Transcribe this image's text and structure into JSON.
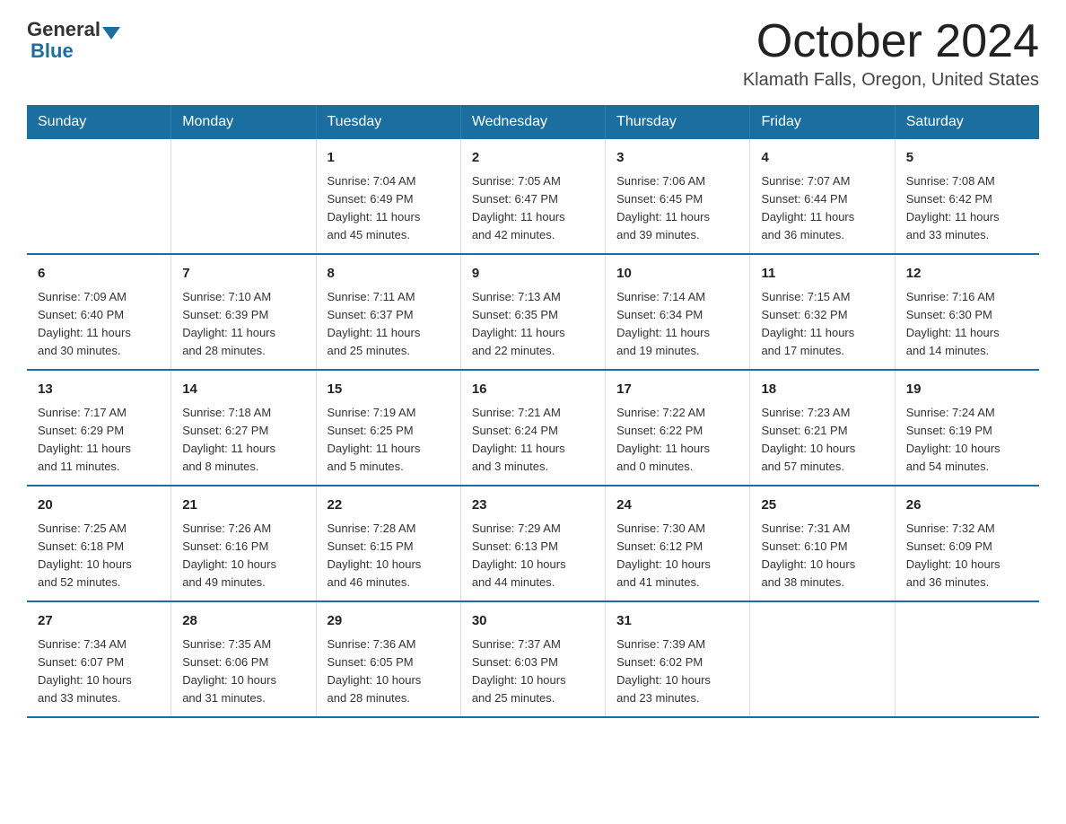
{
  "logo": {
    "general": "General",
    "blue": "Blue"
  },
  "title": "October 2024",
  "location": "Klamath Falls, Oregon, United States",
  "days_of_week": [
    "Sunday",
    "Monday",
    "Tuesday",
    "Wednesday",
    "Thursday",
    "Friday",
    "Saturday"
  ],
  "weeks": [
    [
      {
        "day": "",
        "info": ""
      },
      {
        "day": "",
        "info": ""
      },
      {
        "day": "1",
        "info": "Sunrise: 7:04 AM\nSunset: 6:49 PM\nDaylight: 11 hours\nand 45 minutes."
      },
      {
        "day": "2",
        "info": "Sunrise: 7:05 AM\nSunset: 6:47 PM\nDaylight: 11 hours\nand 42 minutes."
      },
      {
        "day": "3",
        "info": "Sunrise: 7:06 AM\nSunset: 6:45 PM\nDaylight: 11 hours\nand 39 minutes."
      },
      {
        "day": "4",
        "info": "Sunrise: 7:07 AM\nSunset: 6:44 PM\nDaylight: 11 hours\nand 36 minutes."
      },
      {
        "day": "5",
        "info": "Sunrise: 7:08 AM\nSunset: 6:42 PM\nDaylight: 11 hours\nand 33 minutes."
      }
    ],
    [
      {
        "day": "6",
        "info": "Sunrise: 7:09 AM\nSunset: 6:40 PM\nDaylight: 11 hours\nand 30 minutes."
      },
      {
        "day": "7",
        "info": "Sunrise: 7:10 AM\nSunset: 6:39 PM\nDaylight: 11 hours\nand 28 minutes."
      },
      {
        "day": "8",
        "info": "Sunrise: 7:11 AM\nSunset: 6:37 PM\nDaylight: 11 hours\nand 25 minutes."
      },
      {
        "day": "9",
        "info": "Sunrise: 7:13 AM\nSunset: 6:35 PM\nDaylight: 11 hours\nand 22 minutes."
      },
      {
        "day": "10",
        "info": "Sunrise: 7:14 AM\nSunset: 6:34 PM\nDaylight: 11 hours\nand 19 minutes."
      },
      {
        "day": "11",
        "info": "Sunrise: 7:15 AM\nSunset: 6:32 PM\nDaylight: 11 hours\nand 17 minutes."
      },
      {
        "day": "12",
        "info": "Sunrise: 7:16 AM\nSunset: 6:30 PM\nDaylight: 11 hours\nand 14 minutes."
      }
    ],
    [
      {
        "day": "13",
        "info": "Sunrise: 7:17 AM\nSunset: 6:29 PM\nDaylight: 11 hours\nand 11 minutes."
      },
      {
        "day": "14",
        "info": "Sunrise: 7:18 AM\nSunset: 6:27 PM\nDaylight: 11 hours\nand 8 minutes."
      },
      {
        "day": "15",
        "info": "Sunrise: 7:19 AM\nSunset: 6:25 PM\nDaylight: 11 hours\nand 5 minutes."
      },
      {
        "day": "16",
        "info": "Sunrise: 7:21 AM\nSunset: 6:24 PM\nDaylight: 11 hours\nand 3 minutes."
      },
      {
        "day": "17",
        "info": "Sunrise: 7:22 AM\nSunset: 6:22 PM\nDaylight: 11 hours\nand 0 minutes."
      },
      {
        "day": "18",
        "info": "Sunrise: 7:23 AM\nSunset: 6:21 PM\nDaylight: 10 hours\nand 57 minutes."
      },
      {
        "day": "19",
        "info": "Sunrise: 7:24 AM\nSunset: 6:19 PM\nDaylight: 10 hours\nand 54 minutes."
      }
    ],
    [
      {
        "day": "20",
        "info": "Sunrise: 7:25 AM\nSunset: 6:18 PM\nDaylight: 10 hours\nand 52 minutes."
      },
      {
        "day": "21",
        "info": "Sunrise: 7:26 AM\nSunset: 6:16 PM\nDaylight: 10 hours\nand 49 minutes."
      },
      {
        "day": "22",
        "info": "Sunrise: 7:28 AM\nSunset: 6:15 PM\nDaylight: 10 hours\nand 46 minutes."
      },
      {
        "day": "23",
        "info": "Sunrise: 7:29 AM\nSunset: 6:13 PM\nDaylight: 10 hours\nand 44 minutes."
      },
      {
        "day": "24",
        "info": "Sunrise: 7:30 AM\nSunset: 6:12 PM\nDaylight: 10 hours\nand 41 minutes."
      },
      {
        "day": "25",
        "info": "Sunrise: 7:31 AM\nSunset: 6:10 PM\nDaylight: 10 hours\nand 38 minutes."
      },
      {
        "day": "26",
        "info": "Sunrise: 7:32 AM\nSunset: 6:09 PM\nDaylight: 10 hours\nand 36 minutes."
      }
    ],
    [
      {
        "day": "27",
        "info": "Sunrise: 7:34 AM\nSunset: 6:07 PM\nDaylight: 10 hours\nand 33 minutes."
      },
      {
        "day": "28",
        "info": "Sunrise: 7:35 AM\nSunset: 6:06 PM\nDaylight: 10 hours\nand 31 minutes."
      },
      {
        "day": "29",
        "info": "Sunrise: 7:36 AM\nSunset: 6:05 PM\nDaylight: 10 hours\nand 28 minutes."
      },
      {
        "day": "30",
        "info": "Sunrise: 7:37 AM\nSunset: 6:03 PM\nDaylight: 10 hours\nand 25 minutes."
      },
      {
        "day": "31",
        "info": "Sunrise: 7:39 AM\nSunset: 6:02 PM\nDaylight: 10 hours\nand 23 minutes."
      },
      {
        "day": "",
        "info": ""
      },
      {
        "day": "",
        "info": ""
      }
    ]
  ]
}
